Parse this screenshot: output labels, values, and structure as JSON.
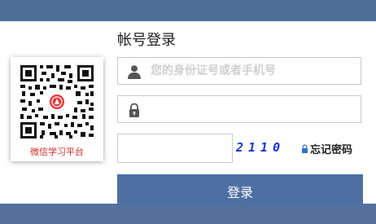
{
  "qr": {
    "caption": "微信学习平台"
  },
  "form": {
    "title": "帐号登录",
    "username": {
      "placeholder": "您的身份证号或者手机号",
      "icon": "user-icon"
    },
    "password": {
      "placeholder": "",
      "icon": "lock-icon"
    },
    "captcha": {
      "value": "",
      "code": "2110"
    },
    "forgot_label": "忘记密码",
    "login_label": "登录"
  },
  "colors": {
    "header_band": "#4f6f99",
    "footer_band": "#54709b",
    "button": "#4d6fa3",
    "captcha_text": "#1a33d6",
    "qr_caption": "#d62828"
  }
}
